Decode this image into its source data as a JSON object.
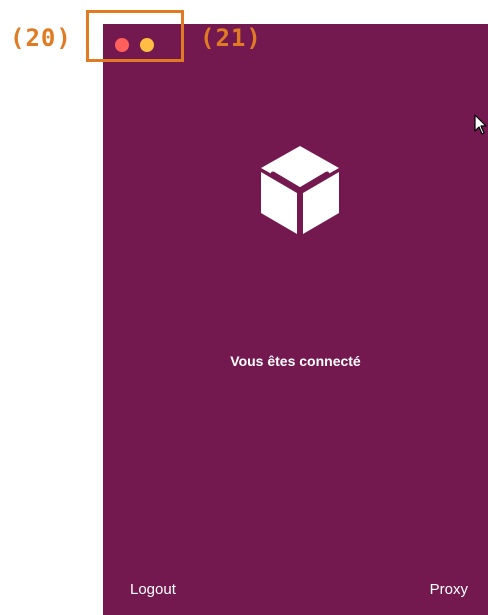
{
  "window": {
    "background_color": "#741950",
    "close_dot_color": "#ff605c",
    "minimize_dot_color": "#ffbd44"
  },
  "logo": {
    "icon": "package-box-icon"
  },
  "status": {
    "text": "Vous êtes connecté"
  },
  "footer": {
    "logout_label": "Logout",
    "proxy_label": "Proxy"
  },
  "annotations": {
    "label_left": "(20)",
    "label_right": "(21)",
    "color": "#e07b24"
  },
  "cursor": {
    "icon": "mouse-pointer-icon"
  }
}
